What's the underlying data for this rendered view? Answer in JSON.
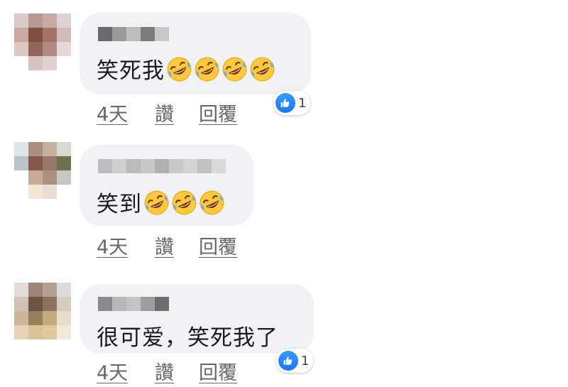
{
  "comments": [
    {
      "text": "笑死我",
      "emoji_icon": "rolling-on-floor-laughing",
      "emoji_count": 4,
      "time": "4天",
      "like_label": "讚",
      "reply_label": "回覆",
      "reaction_count": "1"
    },
    {
      "text": "笑到",
      "emoji_icon": "rolling-on-floor-laughing",
      "emoji_count": 3,
      "time": "4天",
      "like_label": "讚",
      "reply_label": "回覆"
    },
    {
      "text": "很可爱，笑死我了",
      "time": "4天",
      "like_label": "讚",
      "reply_label": "回覆",
      "reaction_count": "1"
    }
  ],
  "colors": {
    "bubble": "#f0f2f5",
    "action_text": "#65676b",
    "like_blue": "#1877f2"
  }
}
